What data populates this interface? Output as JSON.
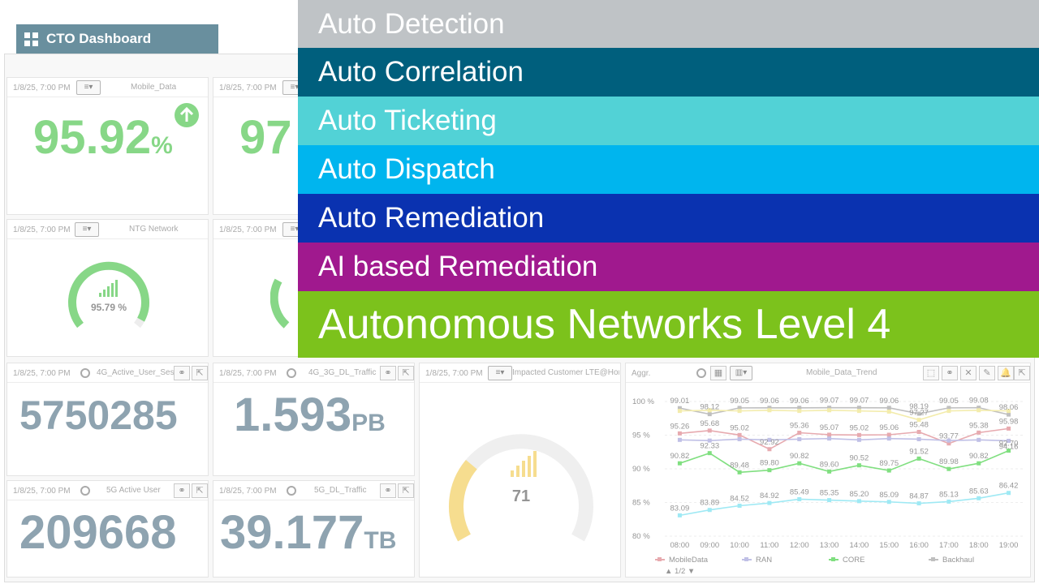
{
  "header": {
    "title": "CTO Dashboard"
  },
  "cards": {
    "mobile": {
      "date": "1/8/25, 7:00 PM",
      "name": "Mobile_Data",
      "value": "95.92",
      "unit": "%",
      "menu": "≡▾"
    },
    "partial1": {
      "date": "1/8/25, 7:00 PM",
      "value": "97",
      "menu": "≡▾"
    },
    "ntg": {
      "date": "1/8/25, 7:00 PM",
      "name": "NTG Network",
      "gauge": "95.79 %",
      "level": 0.9579,
      "menu": "≡▾"
    },
    "partial2": {
      "date": "1/8/25, 7:00 PM",
      "menu": "≡▾"
    },
    "active4g": {
      "date": "1/8/25, 7:00 PM",
      "name": "4G_Active_User_Ses",
      "value": "5750285"
    },
    "traffic4g": {
      "date": "1/8/25, 7:00 PM",
      "name": "4G_3G_DL_Traffic",
      "value": "1.593",
      "unit": "PB"
    },
    "impacted": {
      "date": "1/8/25, 7:00 PM",
      "name": "Impacted Customer LTE@Hom",
      "gauge": "71",
      "level": 0.29,
      "menu": "≡▾"
    },
    "active5g": {
      "date": "1/8/25, 7:00 PM",
      "name": "5G Active User",
      "value": "209668"
    },
    "traffic5g": {
      "date": "1/8/25, 7:00 PM",
      "name": "5G_DL_Traffic",
      "value": "39.177",
      "unit": "TB"
    }
  },
  "trend": {
    "aggr": "Aggr.",
    "title": "Mobile_Data_Trend",
    "pager": "1/2"
  },
  "overlay": {
    "items": [
      {
        "label": "Auto Detection",
        "color": "#bfc3c6"
      },
      {
        "label": "Auto Correlation",
        "color": "#005f7d"
      },
      {
        "label": "Auto Ticketing",
        "color": "#52d2d6"
      },
      {
        "label": "Auto Dispatch",
        "color": "#00b5ee"
      },
      {
        "label": "Auto Remediation",
        "color": "#0a32b0"
      },
      {
        "label": "AI based Remediation",
        "color": "#a0198e"
      },
      {
        "label": "Autonomous Networks Level 4",
        "color": "#7cc21c"
      }
    ]
  },
  "chart_data": {
    "type": "line",
    "title": "Mobile_Data_Trend",
    "x": [
      "08:00",
      "09:00",
      "10:00",
      "11:00",
      "12:00",
      "13:00",
      "14:00",
      "15:00",
      "16:00",
      "17:00",
      "18:00",
      "19:00"
    ],
    "yticks": [
      "100 %",
      "95 %",
      "90 %",
      "85 %",
      "80 %"
    ],
    "ylim": [
      80,
      100
    ],
    "series": [
      {
        "name": "MobileData",
        "color": "#d9777f",
        "values": [
          95.26,
          95.68,
          95.02,
          92.92,
          95.36,
          95.07,
          95.02,
          95.06,
          95.48,
          93.77,
          95.38,
          95.98
        ]
      },
      {
        "name": "RAN",
        "color": "#9a9ad8",
        "values": [
          94.3,
          94.2,
          94.4,
          94.3,
          94.4,
          94.5,
          94.3,
          94.5,
          94.4,
          94.2,
          94.3,
          94.16
        ]
      },
      {
        "name": "CORE",
        "color": "#33cc33",
        "values": [
          90.82,
          92.33,
          89.48,
          89.8,
          90.82,
          89.6,
          90.52,
          89.75,
          91.52,
          89.98,
          90.82,
          92.7
        ]
      },
      {
        "name": "Backhaul",
        "color": "#999999",
        "values": [
          99.01,
          98.12,
          99.05,
          99.06,
          99.06,
          99.07,
          99.07,
          99.06,
          98.19,
          99.05,
          99.08,
          98.06
        ]
      },
      {
        "name": "",
        "color": "#66ddee",
        "values": [
          83.09,
          83.89,
          84.52,
          84.92,
          85.49,
          85.35,
          85.2,
          85.09,
          84.87,
          85.13,
          85.63,
          86.42
        ]
      },
      {
        "name": "",
        "color": "#ede27a",
        "values": [
          98.6,
          98.7,
          98.6,
          98.7,
          98.6,
          98.7,
          98.6,
          98.5,
          97.27,
          98.6,
          98.7,
          98.6
        ]
      }
    ],
    "labels_shown": {
      "MobileData": [
        95.26,
        95.68,
        95.02,
        92.92,
        95.36,
        95.07,
        95.02,
        95.06,
        95.48,
        93.77,
        95.38,
        95.98
      ],
      "CORE": [
        90.82,
        92.33,
        89.48,
        89.8,
        90.82,
        89.6,
        90.52,
        89.75,
        91.52,
        89.98,
        90.82,
        92.7
      ],
      "Backhaul": [
        99.01,
        98.12,
        99.05,
        99.06,
        99.06,
        99.07,
        99.07,
        99.06,
        98.19,
        99.05,
        99.08,
        98.06
      ],
      "extra": [
        83.09,
        83.89,
        84.52,
        84.92,
        85.49,
        85.35,
        85.2,
        85.09,
        84.87,
        85.13,
        85.63,
        86.42
      ],
      "top": [
        null,
        null,
        null,
        null,
        null,
        null,
        null,
        null,
        97.27,
        null,
        null,
        null
      ],
      "RAN": [
        null,
        null,
        null,
        null,
        null,
        null,
        null,
        null,
        null,
        null,
        null,
        94.16
      ]
    }
  }
}
